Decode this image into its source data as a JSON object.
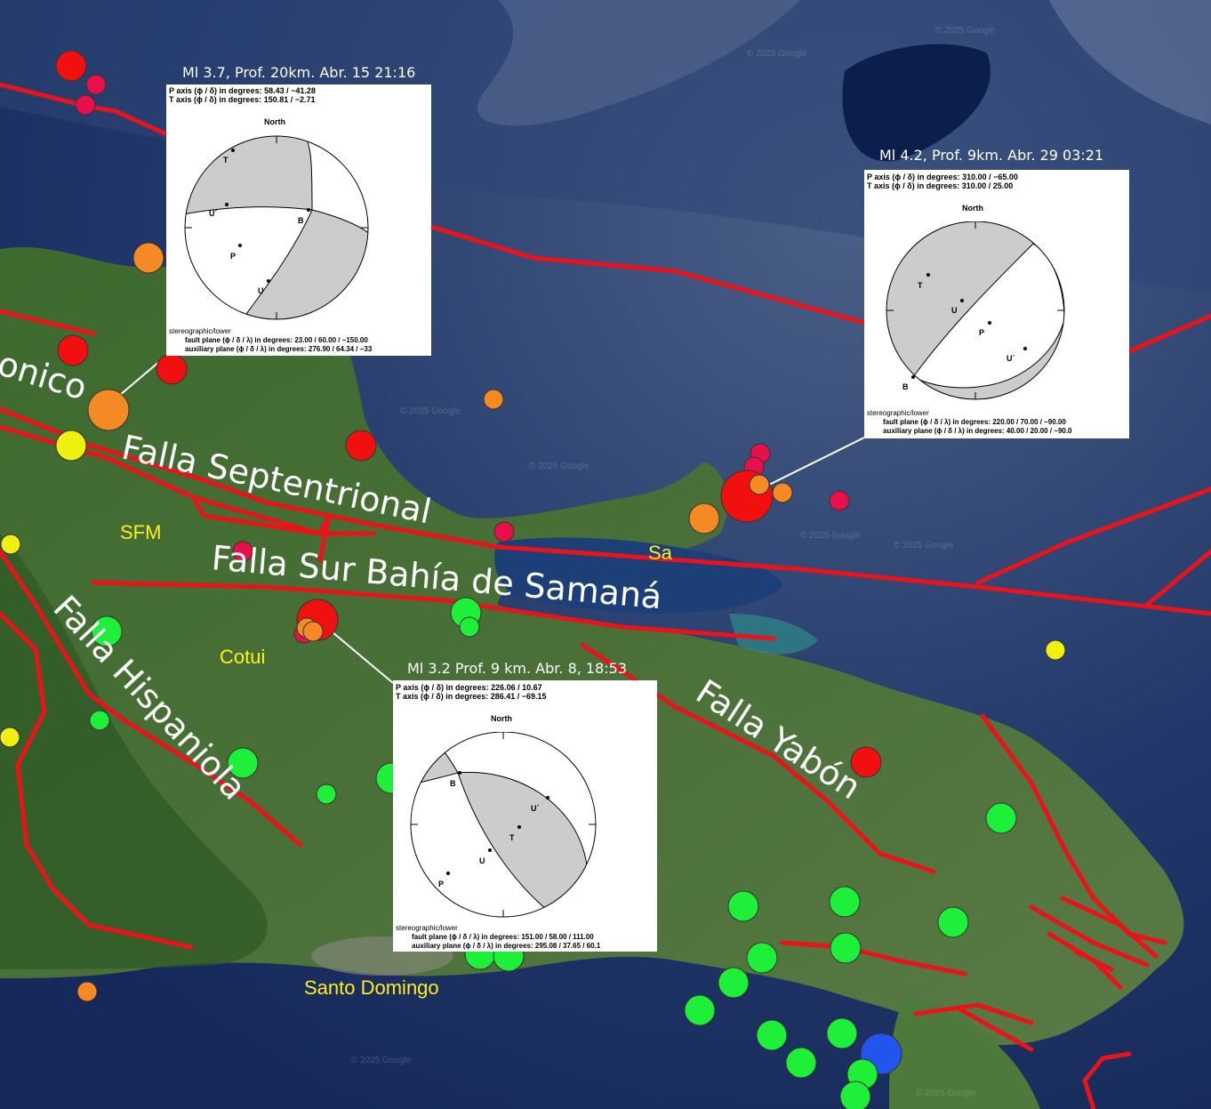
{
  "fault_labels": {
    "falla_septentrional": "Falla Septentrional",
    "falla_sur_bahia": "Falla Sur Bahía de Samaná",
    "falla_hispaniola": "Falla Hispaniola",
    "falla_yabon": "Falla Yabón",
    "falla_oceanico": "onico"
  },
  "place_labels": {
    "sfm": "SFM",
    "cotui": "Cotui",
    "santo_domingo": "Santo Domingo",
    "sa": "Sa"
  },
  "watermark": "© 2025 Google",
  "focal_mechanisms": [
    {
      "title": "Ml 3.7, Prof. 20km. Abr. 15 21:16",
      "p_axis": "P axis (ϕ / δ) in degrees: 58.43 / −41.28",
      "t_axis": "T axis (ϕ / δ) in degrees: 150.81 / −2.71",
      "north": "North",
      "projection": "stereographic/lower",
      "fault_plane": "fault plane (ϕ / δ / λ) in degrees: 23.00 / 60.00 / −150.00",
      "aux_plane": "auxiliary plane (ϕ / δ / λ) in degrees: 276.90 / 64.34 / −33",
      "points": {
        "t": "T",
        "u1": "U´",
        "b": "B",
        "p": "P",
        "u": "U"
      }
    },
    {
      "title": "Ml 4.2, Prof. 9km. Abr. 29 03:21",
      "p_axis": "P axis (ϕ / δ) in degrees: 310.00 / −65.00",
      "t_axis": "T axis (ϕ / δ) in degrees: 310.00 / 25.00",
      "north": "North",
      "projection": "stereographic/lower",
      "fault_plane": "fault plane (ϕ / δ / λ) in degrees: 220.00 / 70.00 / −90.00",
      "aux_plane": "auxiliary plane (ϕ / δ / λ) in degrees: 40.00 / 20.00 / −90.0",
      "points": {
        "t": "T",
        "u": "U",
        "p": "P",
        "u1": "U´",
        "b": "B"
      }
    },
    {
      "title": "Ml 3.2 Prof. 9 km. Abr. 8, 18:53",
      "p_axis": "P axis (ϕ / δ) in degrees: 226.06 / 10.67",
      "t_axis": "T axis (ϕ / δ) in degrees: 286.41 / −69.15",
      "north": "North",
      "projection": "stereographic/lower",
      "fault_plane": "fault plane (ϕ / δ / λ) in degrees: 151.00 / 58.00 / 111.00",
      "aux_plane": "auxiliary plane (ϕ / δ / λ) in degrees: 295.08 / 37.65 / 60.1",
      "points": {
        "b": "B",
        "u1": "U´",
        "t": "T",
        "u": "U",
        "p": "P"
      }
    }
  ],
  "colors": {
    "fault_line": "#e8141a",
    "red": "#f01010",
    "crimson": "#e8104a",
    "orange": "#f58a25",
    "yellow": "#f0f010",
    "green": "#1ef03a",
    "blue": "#2255ee",
    "place_label": "#ffee22"
  }
}
